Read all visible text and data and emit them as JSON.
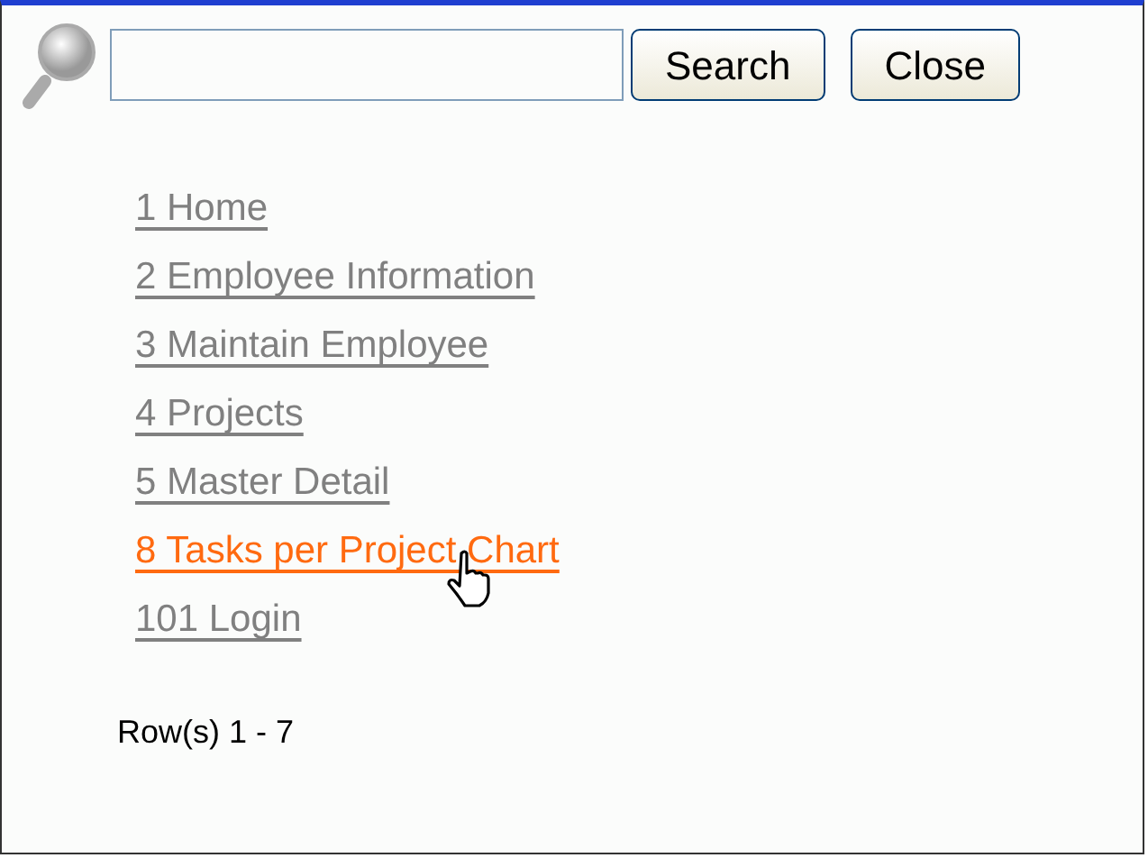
{
  "search": {
    "buttons": [
      "Search",
      "Close"
    ]
  },
  "links": [
    {
      "label": "1 Home",
      "hovered": false
    },
    {
      "label": "2 Employee Information",
      "hovered": false
    },
    {
      "label": "3 Maintain Employee",
      "hovered": false
    },
    {
      "label": "4 Projects",
      "hovered": false
    },
    {
      "label": "5 Master Detail",
      "hovered": false
    },
    {
      "label": "8 Tasks per Project Chart",
      "hovered": true
    },
    {
      "label": "101 Login",
      "hovered": false
    }
  ],
  "row_count": "Row(s) 1 - 7"
}
